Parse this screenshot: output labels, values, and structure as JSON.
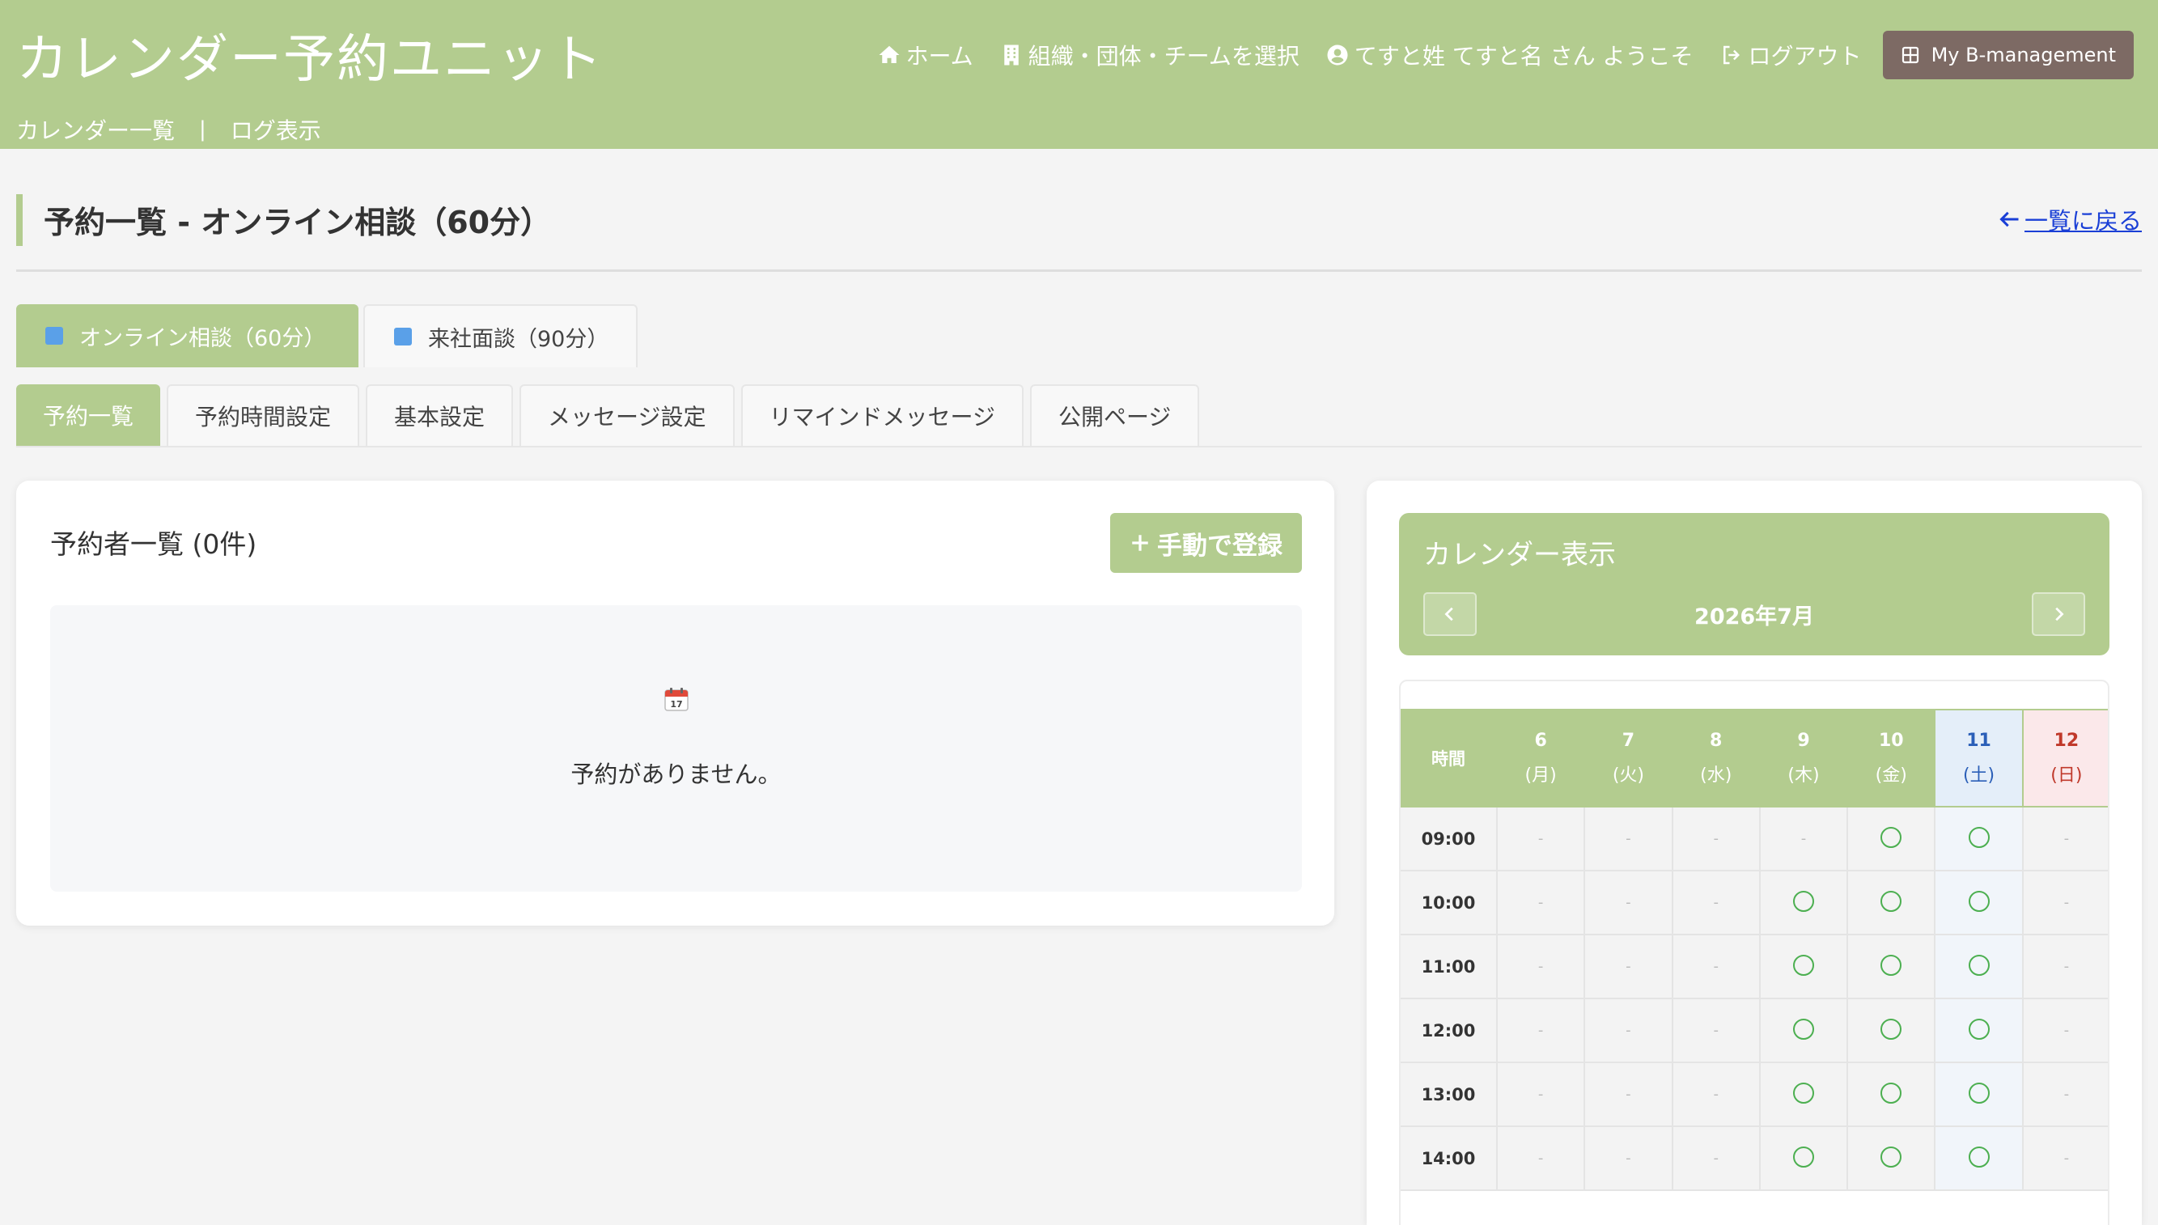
{
  "header": {
    "app_title": "カレンダー予約ユニット",
    "nav": {
      "home": "ホーム",
      "select_org": "組織・団体・チームを選択",
      "welcome": "てすと姓 てすと名 さん ようこそ",
      "logout": "ログアウト",
      "my_bm": "My B-management"
    },
    "subnav": {
      "calendar_list": "カレンダー一覧",
      "separator": "|",
      "log_view": "ログ表示"
    }
  },
  "page": {
    "title": "予約一覧 - オンライン相談（60分）",
    "back_link": "一覧に戻る"
  },
  "calendar_tabs": [
    {
      "label": "オンライン相談（60分）",
      "active": true,
      "color": "#5aa0e8"
    },
    {
      "label": "来社面談（90分）",
      "active": false,
      "color": "#5aa0e8"
    }
  ],
  "function_tabs": [
    {
      "label": "予約一覧",
      "active": true
    },
    {
      "label": "予約時間設定",
      "active": false
    },
    {
      "label": "基本設定",
      "active": false
    },
    {
      "label": "メッセージ設定",
      "active": false
    },
    {
      "label": "リマインドメッセージ",
      "active": false
    },
    {
      "label": "公開ページ",
      "active": false
    }
  ],
  "reservation_list": {
    "title": "予約者一覧 (0件)",
    "add_button": "手動で登録",
    "empty_icon": "calendar-icon",
    "empty_message": "予約がありません。"
  },
  "calendar": {
    "title": "カレンダー表示",
    "month": "2026年7月",
    "time_header": "時間",
    "days": [
      {
        "num": "6",
        "weekday": "(月)",
        "kind": "weekday"
      },
      {
        "num": "7",
        "weekday": "(火)",
        "kind": "weekday"
      },
      {
        "num": "8",
        "weekday": "(水)",
        "kind": "weekday"
      },
      {
        "num": "9",
        "weekday": "(木)",
        "kind": "weekday"
      },
      {
        "num": "10",
        "weekday": "(金)",
        "kind": "weekday"
      },
      {
        "num": "11",
        "weekday": "(土)",
        "kind": "sat"
      },
      {
        "num": "12",
        "weekday": "(日)",
        "kind": "sun"
      }
    ],
    "dash": "-",
    "rows": [
      {
        "time": "09:00",
        "slots": [
          "-",
          "-",
          "-",
          "-",
          "○",
          "○",
          "-"
        ]
      },
      {
        "time": "10:00",
        "slots": [
          "-",
          "-",
          "-",
          "○",
          "○",
          "○",
          "-"
        ]
      },
      {
        "time": "11:00",
        "slots": [
          "-",
          "-",
          "-",
          "○",
          "○",
          "○",
          "-"
        ]
      },
      {
        "time": "12:00",
        "slots": [
          "-",
          "-",
          "-",
          "○",
          "○",
          "○",
          "-"
        ]
      },
      {
        "time": "13:00",
        "slots": [
          "-",
          "-",
          "-",
          "○",
          "○",
          "○",
          "-"
        ]
      },
      {
        "time": "14:00",
        "slots": [
          "-",
          "-",
          "-",
          "○",
          "○",
          "○",
          "-"
        ]
      }
    ]
  },
  "colors": {
    "brand_green": "#b3cc8f",
    "my_bm_button": "#7d6a64",
    "link_blue": "#1a3fd6",
    "available": "#4caf50"
  }
}
